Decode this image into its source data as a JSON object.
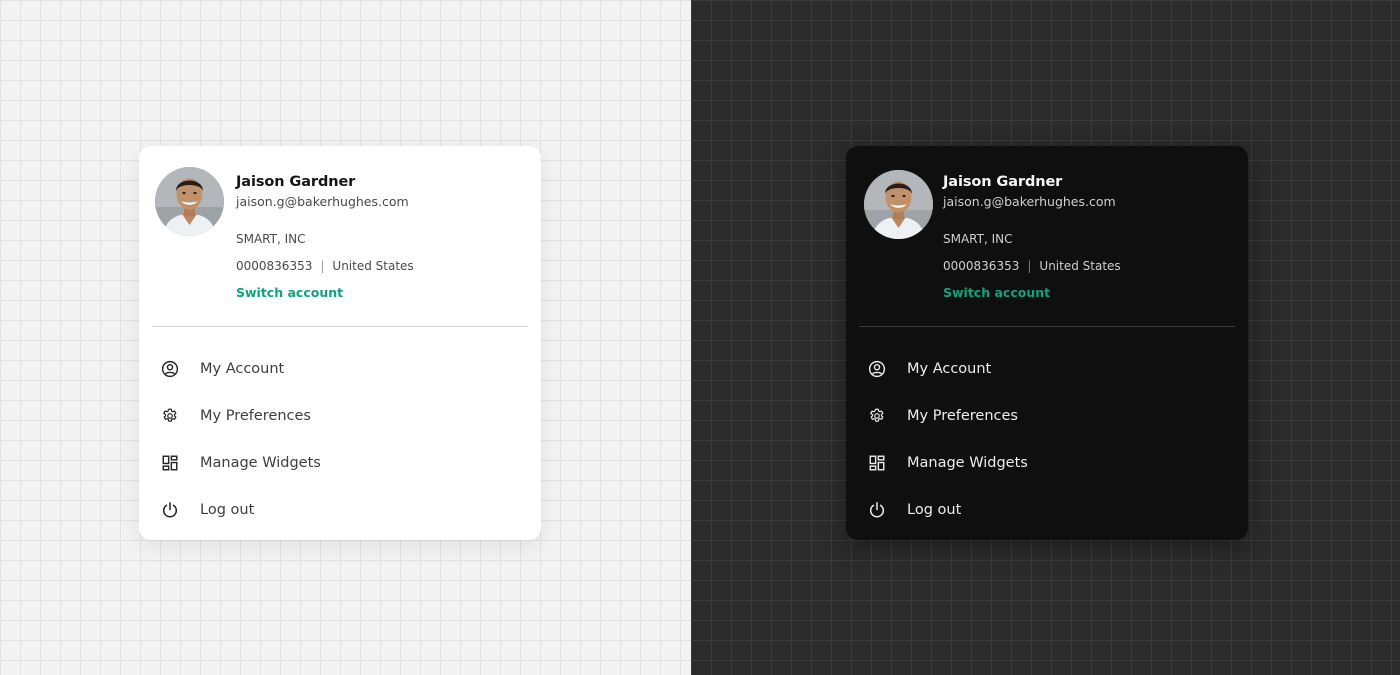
{
  "profile": {
    "name": "Jaison Gardner",
    "email": "jaison.g@bakerhughes.com",
    "company": "SMART, INC",
    "account_number": "0000836353",
    "separator": "|",
    "country": "United States",
    "switch_account_label": "Switch account"
  },
  "menu": {
    "my_account": "My Account",
    "my_preferences": "My Preferences",
    "manage_widgets": "Manage Widgets",
    "log_out": "Log out"
  },
  "colors": {
    "accent": "#10a37f",
    "light_card": "#ffffff",
    "dark_card": "#0f0f0f",
    "light_background": "#f3f3f3",
    "dark_background": "#2b2b2b"
  },
  "icons": [
    "user-circle-icon",
    "gear-icon",
    "widgets-grid-icon",
    "power-icon"
  ]
}
